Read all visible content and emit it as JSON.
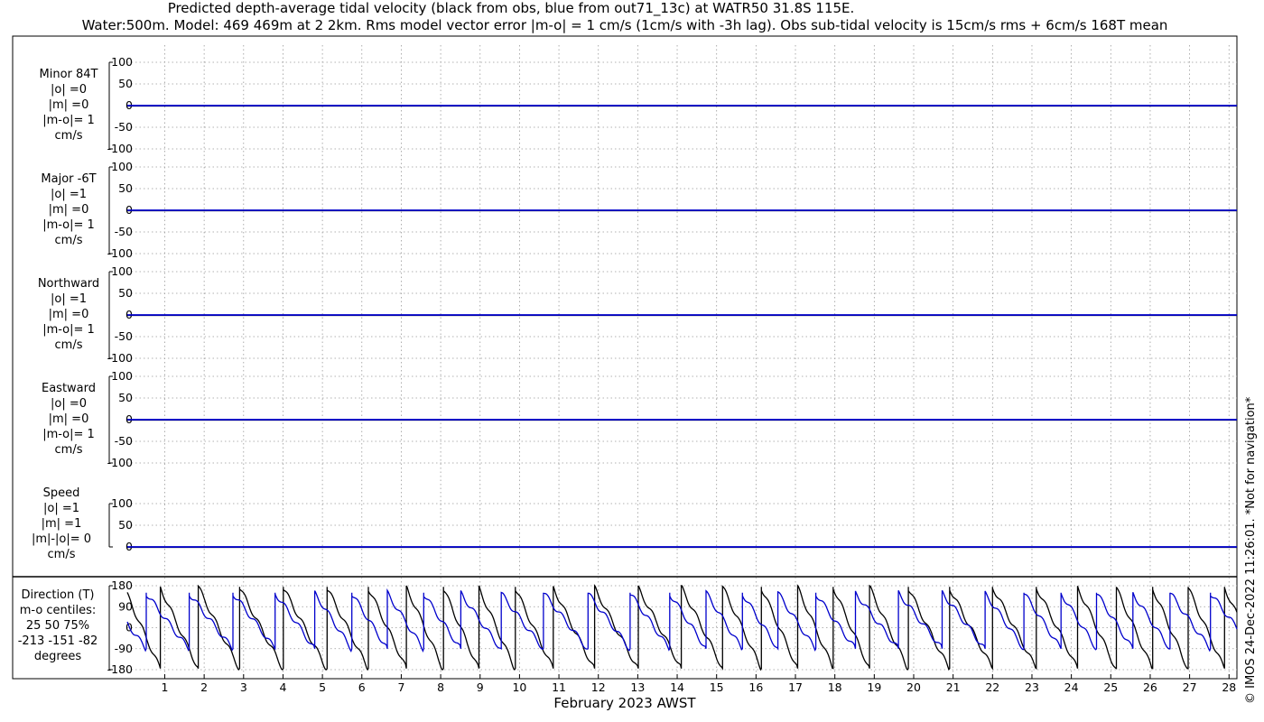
{
  "title_line1": "Predicted depth-average tidal velocity (black from obs, blue from out71_13c) at WATR50 31.8S 115E.",
  "title_line2": "Water:500m. Model: 469 469m at 2 2km. Rms model vector error |m-o| = 1 cm/s (1cm/s with -3h lag). Obs sub-tidal velocity is 15cm/s rms + 6cm/s 168T mean",
  "copyright": "© IMOS 24-Dec-2022 11:26:01. *Not for navigation*",
  "colors": {
    "obs": "#000000",
    "model": "#0000cc",
    "grid": "#999999"
  },
  "chart_data": {
    "type": "line",
    "xlabel": "February 2023 AWST",
    "x_ticks": [
      "1",
      "2",
      "3",
      "4",
      "5",
      "6",
      "7",
      "8",
      "9",
      "10",
      "11",
      "12",
      "13",
      "14",
      "15",
      "16",
      "17",
      "18",
      "19",
      "20",
      "21",
      "22",
      "23",
      "24",
      "25",
      "26",
      "27",
      "28"
    ],
    "x_range_days": [
      0.05,
      28.2
    ],
    "legend": "in title",
    "grid": true,
    "panels": [
      {
        "name": "minor",
        "label_lines": [
          "Minor 84T",
          "|o| =0",
          "|m| =0",
          "|m-o|= 1",
          "cm/s"
        ],
        "ylim": [
          -100,
          100
        ],
        "y_ticks": [
          "100",
          "50",
          "0",
          "-50",
          "-100"
        ],
        "series_values": "approximately 0 for both obs and model"
      },
      {
        "name": "major",
        "label_lines": [
          "Major -6T",
          "|o| =1",
          "|m| =0",
          "|m-o|= 1",
          "cm/s"
        ],
        "ylim": [
          -100,
          100
        ],
        "y_ticks": [
          "100",
          "50",
          "0",
          "-50",
          "-100"
        ],
        "series_values": "approximately 0 for both obs and model"
      },
      {
        "name": "northward",
        "label_lines": [
          "Northward",
          "|o| =1",
          "|m| =0",
          "|m-o|= 1",
          "cm/s"
        ],
        "ylim": [
          -100,
          100
        ],
        "y_ticks": [
          "100",
          "50",
          "0",
          "-50",
          "-100"
        ],
        "series_values": "approximately 0 for both obs and model"
      },
      {
        "name": "eastward",
        "label_lines": [
          "Eastward",
          "|o| =0",
          "|m| =0",
          "|m-o|= 1",
          "cm/s"
        ],
        "ylim": [
          -100,
          100
        ],
        "y_ticks": [
          "100",
          "50",
          "0",
          "-50",
          "-100"
        ],
        "series_values": "approximately 0 for both obs and model"
      },
      {
        "name": "speed",
        "label_lines": [
          "Speed",
          "|o| =1",
          "|m| =1",
          "|m|-|o|= 0",
          "cm/s"
        ],
        "ylim": [
          0,
          100
        ],
        "y_ticks": [
          "100",
          "50",
          "0"
        ],
        "series_values": "approximately 0-1 for both obs and model"
      },
      {
        "name": "direction",
        "label_lines": [
          "Direction (T)",
          "m-o centiles:",
          "25  50  75%",
          "-213 -151  -82",
          "degrees"
        ],
        "ylim": [
          -180,
          180
        ],
        "y_ticks": [
          "180",
          "90",
          "0",
          "-90",
          "-180"
        ],
        "series": [
          {
            "description": "obs direction: sawtooth decreasing from ~180 to ~-180 roughly once per day"
          },
          {
            "description": "model direction: sawtooth from ~150 down to ~-90 roughly once per day, lagged behind obs"
          }
        ]
      }
    ]
  }
}
